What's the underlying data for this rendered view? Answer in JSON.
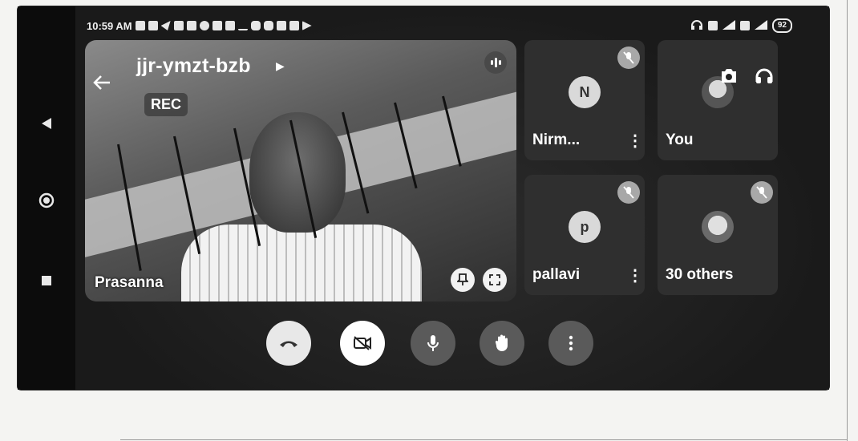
{
  "status_bar": {
    "time": "10:59 AM",
    "battery": "92"
  },
  "meeting": {
    "code": "jjr-ymzt-bzb",
    "recording_label": "REC"
  },
  "main_tile": {
    "participant_name": "Prasanna"
  },
  "participants": [
    {
      "initial": "N",
      "name": "Nirm...",
      "muted": true
    },
    {
      "initial": "",
      "name": "You",
      "muted": false
    },
    {
      "initial": "p",
      "name": "pallavi",
      "muted": true
    },
    {
      "initial": "",
      "name": "30 others",
      "muted": true
    }
  ],
  "icons": {
    "nav": [
      "back-triangle-icon",
      "home-circle-icon",
      "recents-square-icon"
    ],
    "header": [
      "switch-camera-icon",
      "headphones-icon"
    ],
    "controls": [
      "end-call-icon",
      "camera-off-icon",
      "microphone-icon",
      "raise-hand-icon",
      "more-options-icon"
    ]
  },
  "colors": {
    "end_call": "#e8e8e8",
    "camera_off": "#ffffff",
    "control_bg": "#5a5a5a"
  }
}
